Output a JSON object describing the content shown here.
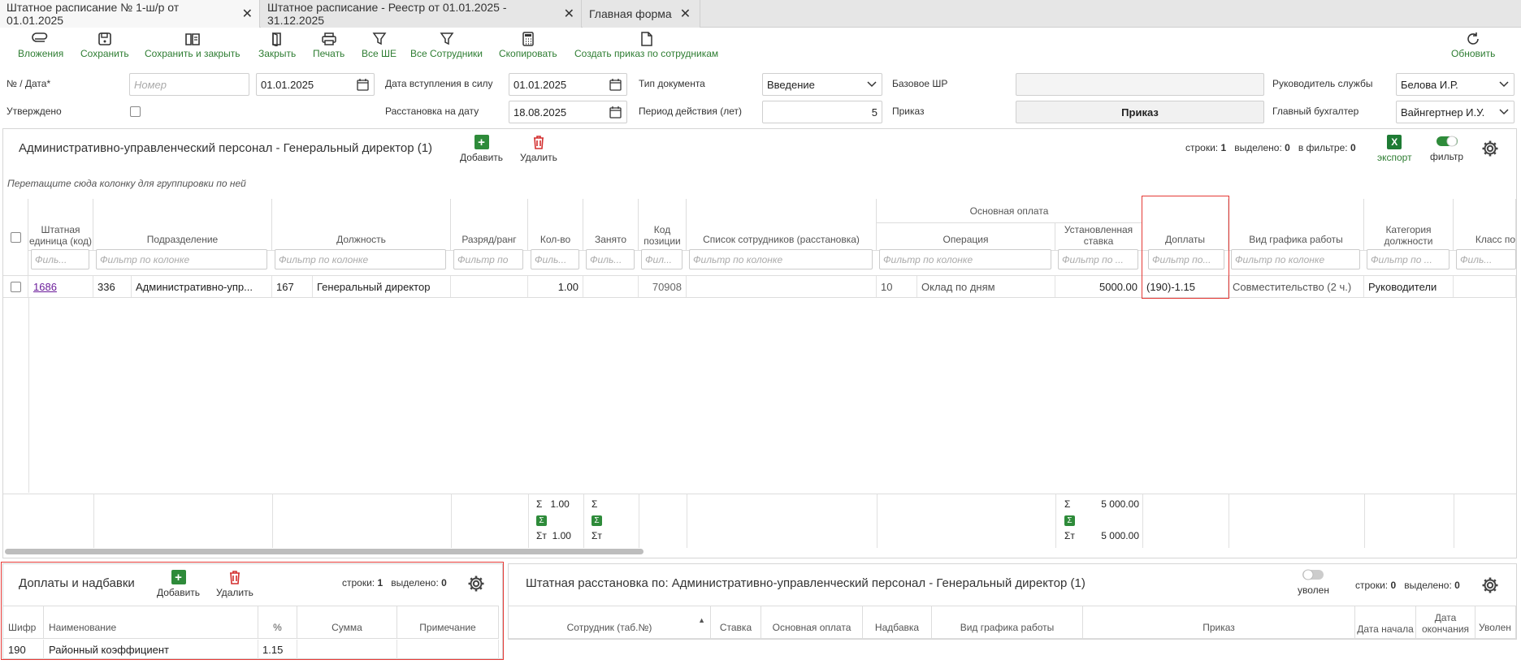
{
  "tabs": [
    {
      "label": "Штатное расписание № 1-ш/р от 01.01.2025"
    },
    {
      "label": "Штатное расписание - Реестр от 01.01.2025 - 31.12.2025"
    },
    {
      "label": "Главная форма"
    }
  ],
  "toolbar": {
    "attachments": "Вложения",
    "save": "Сохранить",
    "save_close": "Сохранить и закрыть",
    "close": "Закрыть",
    "print": "Печать",
    "all_units": "Все ШЕ",
    "all_employees": "Все Сотрудники",
    "copy": "Скопировать",
    "create_order": "Создать приказ по сотрудникам",
    "refresh": "Обновить"
  },
  "form": {
    "num_date_label": "№ / Дата*",
    "num_placeholder": "Номер",
    "date_value": "01.01.2025",
    "approved_label": "Утверждено",
    "effective_label": "Дата вступления в силу",
    "effective_value": "01.01.2025",
    "placement_label": "Расстановка на дату",
    "placement_value": "18.08.2025",
    "doctype_label": "Тип документа",
    "doctype_value": "Введение",
    "period_label": "Период действия (лет)",
    "period_value": "5",
    "base_label": "Базовое ШР",
    "base_value": "",
    "order_label": "Приказ",
    "order_button": "Приказ",
    "head_label": "Руководитель службы",
    "head_value": "Белова И.Р.",
    "accountant_label": "Главный бухгалтер",
    "accountant_value": "Вайнгертнер И.У."
  },
  "main_panel": {
    "title": "Административно-управленческий персонал - Генеральный директор (1)",
    "add": "Добавить",
    "delete": "Удалить",
    "rows_label": "строки:",
    "rows_value": "1",
    "selected_label": "выделено:",
    "selected_value": "0",
    "filtered_label": "в фильтре:",
    "filtered_value": "0",
    "export": "экспорт",
    "filter": "фильтр",
    "group_hint": "Перетащите сюда колонку для группировки по ней",
    "filter_placeholder": "Фильтр по колонке",
    "filter_short": "Филь...",
    "filter_mid": "Фильтр по ...",
    "filter_mid2": "Фильтр по...",
    "filter_fil": "Фил...",
    "filter_rank": "Фильтр по",
    "col_group_basic": "Основная оплата",
    "columns": {
      "unit": "Штатная единица (код)",
      "dept": "Подразделение",
      "position": "Должность",
      "rank": "Разряд/ранг",
      "qty": "Кол-во",
      "occupied": "Занято",
      "poscode": "Код позиции",
      "employees": "Список сотрудников (расстановка)",
      "operation": "Операция",
      "rate": "Установленная ставка",
      "extra": "Доплаты",
      "schedule": "Вид графика работы",
      "category": "Категория должности",
      "class": "Класс по"
    },
    "row": {
      "unit": "1686",
      "dept_code": "336",
      "dept": "Административно-упр...",
      "pos_code": "167",
      "position": "Генеральный директор",
      "qty": "1.00",
      "poscode": "70908",
      "op_code": "10",
      "operation": "Оклад по дням",
      "rate": "5000.00",
      "extra": "(190)-1.15",
      "schedule": "Совместительство (2 ч.)",
      "category": "Руководители"
    },
    "totals": {
      "sigma": "Σ",
      "sigma_t": "Σт",
      "qty_sum": "1.00",
      "qty_sum_t": "1.00",
      "rate_sum": "5 000.00",
      "rate_sum_t": "5 000.00"
    }
  },
  "extras_panel": {
    "title": "Доплаты и надбавки",
    "add": "Добавить",
    "delete": "Удалить",
    "rows_label": "строки:",
    "rows_value": "1",
    "selected_label": "выделено:",
    "selected_value": "0",
    "columns": {
      "code": "Шифр",
      "name": "Наименование",
      "pct": "%",
      "sum": "Сумма",
      "note": "Примечание"
    },
    "row": {
      "code": "190",
      "name": "Районный коэффициент",
      "pct": "1.15"
    }
  },
  "placement_panel": {
    "title": "Штатная расстановка по: Административно-управленческий персонал - Генеральный директор (1)",
    "dismissed": "уволен",
    "rows_label": "строки:",
    "rows_value": "0",
    "selected_label": "выделено:",
    "selected_value": "0",
    "columns": {
      "employee": "Сотрудник (таб.№)",
      "rate": "Ставка",
      "basic": "Основная оплата",
      "bonus": "Надбавка",
      "schedule": "Вид графика работы",
      "order": "Приказ",
      "start": "Дата начала",
      "end": "Дата окончания",
      "dismissed": "Уволен"
    }
  },
  "colors": {
    "accent": "#2e7d32",
    "highlight": "#e53935",
    "link": "#6a1b9a"
  }
}
